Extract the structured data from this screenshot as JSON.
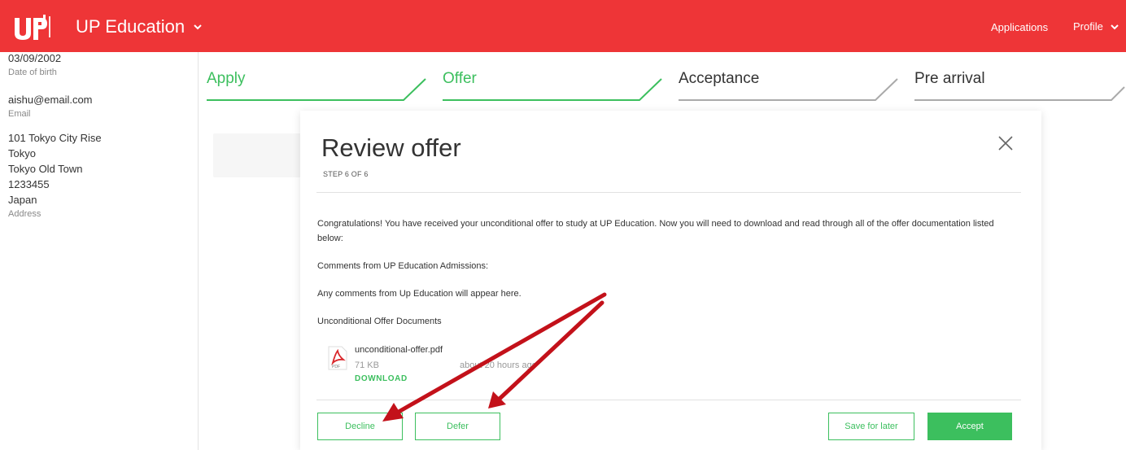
{
  "header": {
    "brand_title": "UP Education",
    "nav_applications": "Applications",
    "nav_profile": "Profile",
    "colors": {
      "header_bg": "#ee3537",
      "accent_green": "#3cbf5e",
      "annotation_red": "#c3111a"
    }
  },
  "sidebar": {
    "date_of_birth": "03/09/2002",
    "date_of_birth_label": "Date of birth",
    "email": "aishu@email.com",
    "email_label": "Email",
    "address_lines": [
      "101 Tokyo City Rise",
      "Tokyo",
      "Tokyo Old Town",
      "1233455",
      "Japan"
    ],
    "address_label": "Address"
  },
  "steps": [
    {
      "label": "Apply",
      "state": "done"
    },
    {
      "label": "Offer",
      "state": "current"
    },
    {
      "label": "Acceptance",
      "state": "todo"
    },
    {
      "label": "Pre arrival",
      "state": "todo"
    }
  ],
  "modal": {
    "title": "Review offer",
    "step_text": "STEP 6 OF 6",
    "congrats_line1": "Congratulations! You have received your unconditional offer to study at UP Education. Now you will need to download and read through all of the offer documentation listed",
    "congrats_line2": "below:",
    "comments_heading": "Comments from UP Education Admissions:",
    "comments_body": "Any comments from Up Education will appear here.",
    "documents_heading": "Unconditional Offer Documents",
    "file": {
      "name": "unconditional-offer.pdf",
      "size": "71 KB",
      "uploaded": "about 20 hours ago",
      "download_label": "DOWNLOAD",
      "icon": "pdf-icon"
    },
    "buttons": {
      "decline": "Decline",
      "defer": "Defer",
      "save_later": "Save for later",
      "accept": "Accept"
    }
  }
}
